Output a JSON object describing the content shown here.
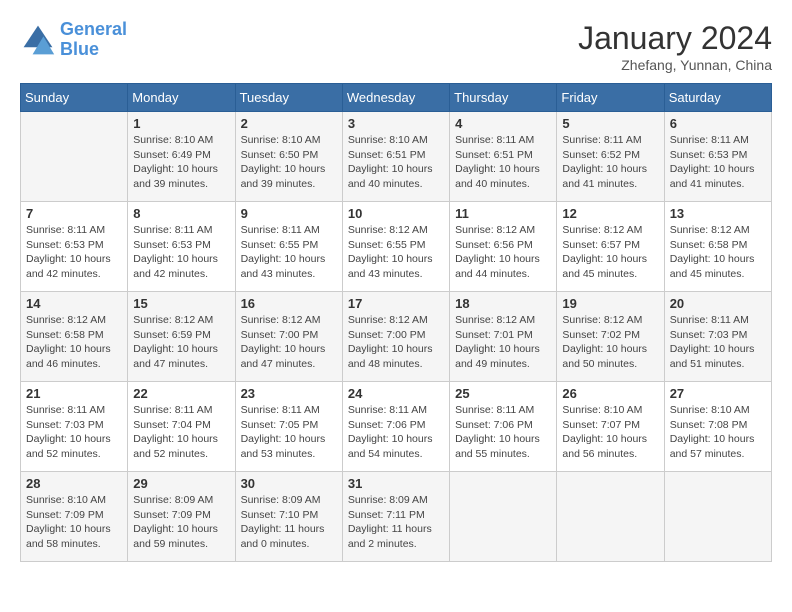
{
  "header": {
    "logo_general": "General",
    "logo_blue": "Blue",
    "title": "January 2024",
    "subtitle": "Zhefang, Yunnan, China"
  },
  "calendar": {
    "days_of_week": [
      "Sunday",
      "Monday",
      "Tuesday",
      "Wednesday",
      "Thursday",
      "Friday",
      "Saturday"
    ],
    "weeks": [
      [
        {
          "day": "",
          "sunrise": "",
          "sunset": "",
          "daylight": ""
        },
        {
          "day": "1",
          "sunrise": "Sunrise: 8:10 AM",
          "sunset": "Sunset: 6:49 PM",
          "daylight": "Daylight: 10 hours and 39 minutes."
        },
        {
          "day": "2",
          "sunrise": "Sunrise: 8:10 AM",
          "sunset": "Sunset: 6:50 PM",
          "daylight": "Daylight: 10 hours and 39 minutes."
        },
        {
          "day": "3",
          "sunrise": "Sunrise: 8:10 AM",
          "sunset": "Sunset: 6:51 PM",
          "daylight": "Daylight: 10 hours and 40 minutes."
        },
        {
          "day": "4",
          "sunrise": "Sunrise: 8:11 AM",
          "sunset": "Sunset: 6:51 PM",
          "daylight": "Daylight: 10 hours and 40 minutes."
        },
        {
          "day": "5",
          "sunrise": "Sunrise: 8:11 AM",
          "sunset": "Sunset: 6:52 PM",
          "daylight": "Daylight: 10 hours and 41 minutes."
        },
        {
          "day": "6",
          "sunrise": "Sunrise: 8:11 AM",
          "sunset": "Sunset: 6:53 PM",
          "daylight": "Daylight: 10 hours and 41 minutes."
        }
      ],
      [
        {
          "day": "7",
          "sunrise": "Sunrise: 8:11 AM",
          "sunset": "Sunset: 6:53 PM",
          "daylight": "Daylight: 10 hours and 42 minutes."
        },
        {
          "day": "8",
          "sunrise": "Sunrise: 8:11 AM",
          "sunset": "Sunset: 6:53 PM",
          "daylight": "Daylight: 10 hours and 42 minutes."
        },
        {
          "day": "9",
          "sunrise": "Sunrise: 8:11 AM",
          "sunset": "Sunset: 6:55 PM",
          "daylight": "Daylight: 10 hours and 43 minutes."
        },
        {
          "day": "10",
          "sunrise": "Sunrise: 8:12 AM",
          "sunset": "Sunset: 6:55 PM",
          "daylight": "Daylight: 10 hours and 43 minutes."
        },
        {
          "day": "11",
          "sunrise": "Sunrise: 8:12 AM",
          "sunset": "Sunset: 6:56 PM",
          "daylight": "Daylight: 10 hours and 44 minutes."
        },
        {
          "day": "12",
          "sunrise": "Sunrise: 8:12 AM",
          "sunset": "Sunset: 6:57 PM",
          "daylight": "Daylight: 10 hours and 45 minutes."
        },
        {
          "day": "13",
          "sunrise": "Sunrise: 8:12 AM",
          "sunset": "Sunset: 6:58 PM",
          "daylight": "Daylight: 10 hours and 45 minutes."
        }
      ],
      [
        {
          "day": "14",
          "sunrise": "Sunrise: 8:12 AM",
          "sunset": "Sunset: 6:58 PM",
          "daylight": "Daylight: 10 hours and 46 minutes."
        },
        {
          "day": "15",
          "sunrise": "Sunrise: 8:12 AM",
          "sunset": "Sunset: 6:59 PM",
          "daylight": "Daylight: 10 hours and 47 minutes."
        },
        {
          "day": "16",
          "sunrise": "Sunrise: 8:12 AM",
          "sunset": "Sunset: 7:00 PM",
          "daylight": "Daylight: 10 hours and 47 minutes."
        },
        {
          "day": "17",
          "sunrise": "Sunrise: 8:12 AM",
          "sunset": "Sunset: 7:00 PM",
          "daylight": "Daylight: 10 hours and 48 minutes."
        },
        {
          "day": "18",
          "sunrise": "Sunrise: 8:12 AM",
          "sunset": "Sunset: 7:01 PM",
          "daylight": "Daylight: 10 hours and 49 minutes."
        },
        {
          "day": "19",
          "sunrise": "Sunrise: 8:12 AM",
          "sunset": "Sunset: 7:02 PM",
          "daylight": "Daylight: 10 hours and 50 minutes."
        },
        {
          "day": "20",
          "sunrise": "Sunrise: 8:11 AM",
          "sunset": "Sunset: 7:03 PM",
          "daylight": "Daylight: 10 hours and 51 minutes."
        }
      ],
      [
        {
          "day": "21",
          "sunrise": "Sunrise: 8:11 AM",
          "sunset": "Sunset: 7:03 PM",
          "daylight": "Daylight: 10 hours and 52 minutes."
        },
        {
          "day": "22",
          "sunrise": "Sunrise: 8:11 AM",
          "sunset": "Sunset: 7:04 PM",
          "daylight": "Daylight: 10 hours and 52 minutes."
        },
        {
          "day": "23",
          "sunrise": "Sunrise: 8:11 AM",
          "sunset": "Sunset: 7:05 PM",
          "daylight": "Daylight: 10 hours and 53 minutes."
        },
        {
          "day": "24",
          "sunrise": "Sunrise: 8:11 AM",
          "sunset": "Sunset: 7:06 PM",
          "daylight": "Daylight: 10 hours and 54 minutes."
        },
        {
          "day": "25",
          "sunrise": "Sunrise: 8:11 AM",
          "sunset": "Sunset: 7:06 PM",
          "daylight": "Daylight: 10 hours and 55 minutes."
        },
        {
          "day": "26",
          "sunrise": "Sunrise: 8:10 AM",
          "sunset": "Sunset: 7:07 PM",
          "daylight": "Daylight: 10 hours and 56 minutes."
        },
        {
          "day": "27",
          "sunrise": "Sunrise: 8:10 AM",
          "sunset": "Sunset: 7:08 PM",
          "daylight": "Daylight: 10 hours and 57 minutes."
        }
      ],
      [
        {
          "day": "28",
          "sunrise": "Sunrise: 8:10 AM",
          "sunset": "Sunset: 7:09 PM",
          "daylight": "Daylight: 10 hours and 58 minutes."
        },
        {
          "day": "29",
          "sunrise": "Sunrise: 8:09 AM",
          "sunset": "Sunset: 7:09 PM",
          "daylight": "Daylight: 10 hours and 59 minutes."
        },
        {
          "day": "30",
          "sunrise": "Sunrise: 8:09 AM",
          "sunset": "Sunset: 7:10 PM",
          "daylight": "Daylight: 11 hours and 0 minutes."
        },
        {
          "day": "31",
          "sunrise": "Sunrise: 8:09 AM",
          "sunset": "Sunset: 7:11 PM",
          "daylight": "Daylight: 11 hours and 2 minutes."
        },
        {
          "day": "",
          "sunrise": "",
          "sunset": "",
          "daylight": ""
        },
        {
          "day": "",
          "sunrise": "",
          "sunset": "",
          "daylight": ""
        },
        {
          "day": "",
          "sunrise": "",
          "sunset": "",
          "daylight": ""
        }
      ]
    ]
  }
}
